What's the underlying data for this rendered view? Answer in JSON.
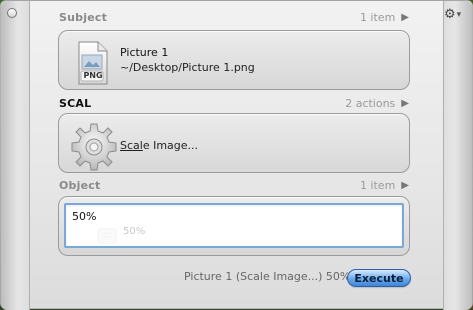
{
  "window": {
    "close_icon": "close-circle-icon",
    "gear_menu_icon": "gear-icon"
  },
  "subject": {
    "header": "Subject",
    "count": "1 item",
    "file_icon_label": "PNG",
    "item_title": "Picture 1",
    "item_path": "~/Desktop/Picture 1.png"
  },
  "action": {
    "header": "SCAL",
    "count": "2 actions",
    "label_prefix_underlined": "Scal",
    "label_rest": "e Image..."
  },
  "object": {
    "header": "Object",
    "count": "1 item",
    "value": "50%",
    "ghost_value": "50%"
  },
  "footer": {
    "status": "Picture 1 (Scale Image...) 50%",
    "execute_label": "Execute"
  },
  "colors": {
    "focus_ring": "#7aa7d9",
    "execute_blue": "#3e86d6"
  }
}
